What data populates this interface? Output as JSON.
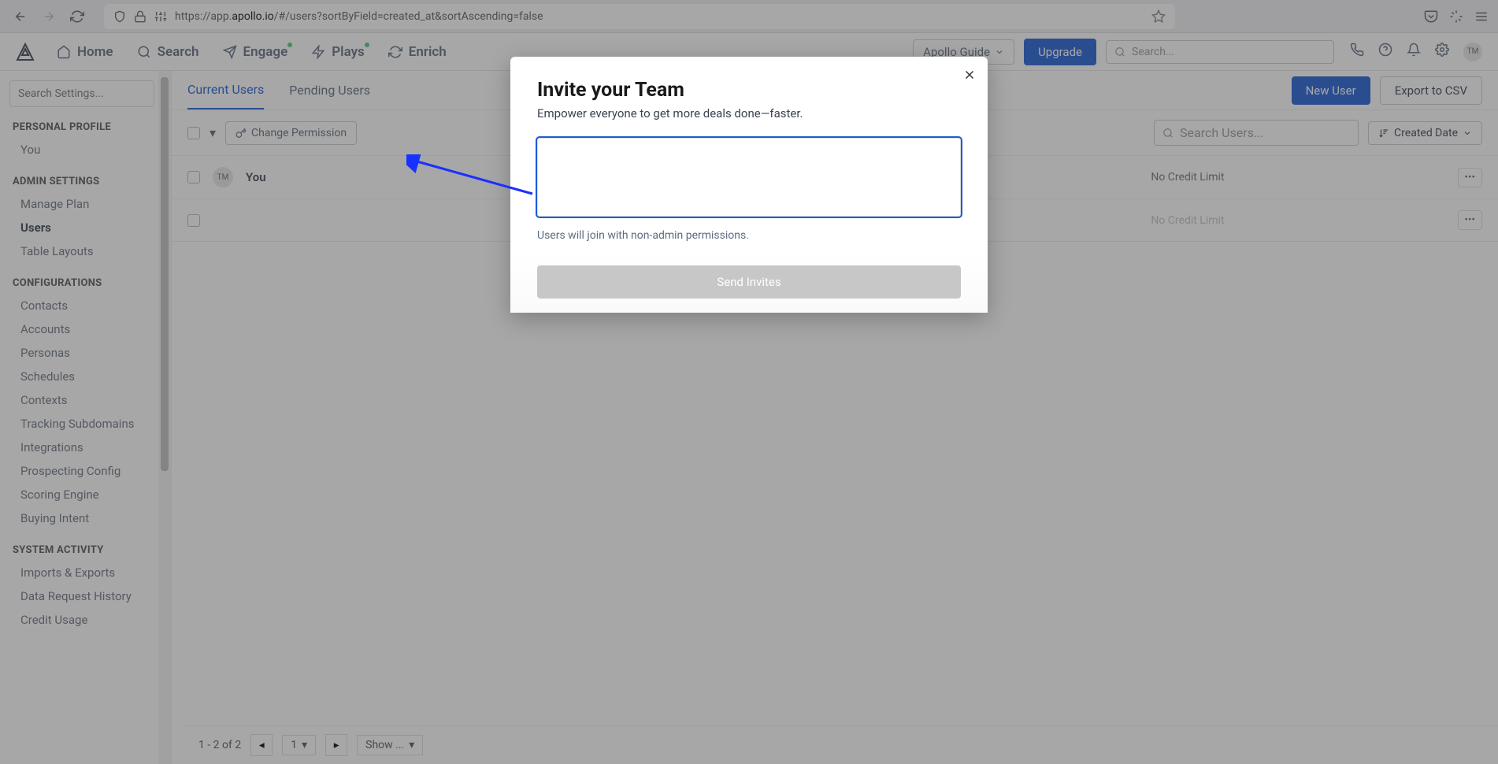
{
  "browser": {
    "url_prefix": "https://app.",
    "url_domain": "apollo.io",
    "url_rest": "/#/users?sortByField=created_at&sortAscending=false"
  },
  "topnav": {
    "home": "Home",
    "search": "Search",
    "engage": "Engage",
    "plays": "Plays",
    "enrich": "Enrich",
    "guide": "Apollo Guide",
    "upgrade": "Upgrade",
    "search_placeholder": "Search...",
    "avatar": "TM"
  },
  "sidebar": {
    "search_placeholder": "Search Settings...",
    "personal_profile": "PERSONAL PROFILE",
    "you": "You",
    "admin_settings": "ADMIN SETTINGS",
    "manage_plan": "Manage Plan",
    "users": "Users",
    "table_layouts": "Table Layouts",
    "configurations": "CONFIGURATIONS",
    "contacts": "Contacts",
    "accounts": "Accounts",
    "personas": "Personas",
    "schedules": "Schedules",
    "contexts": "Contexts",
    "tracking": "Tracking Subdomains",
    "integrations": "Integrations",
    "prospecting": "Prospecting Config",
    "scoring": "Scoring Engine",
    "buying": "Buying Intent",
    "system_activity": "SYSTEM ACTIVITY",
    "imports": "Imports & Exports",
    "data_request": "Data Request History",
    "credit_usage": "Credit Usage"
  },
  "tabs": {
    "current": "Current Users",
    "pending": "Pending Users",
    "new_user": "New User",
    "export": "Export to CSV"
  },
  "toolbar": {
    "change_permission": "Change Permission",
    "search_users_placeholder": "Search Users...",
    "sort_label": "Created Date"
  },
  "table": {
    "row1_avatar": "TM",
    "row1_name": "You",
    "row1_credit": "No Credit Limit",
    "row2_credit": "No Credit Limit"
  },
  "pagination": {
    "range": "1 - 2 of 2",
    "page": "1",
    "show": "Show ..."
  },
  "modal": {
    "title": "Invite your Team",
    "subtitle": "Empower everyone to get more deals done—faster.",
    "note": "Users will join with non-admin permissions.",
    "send": "Send Invites"
  }
}
